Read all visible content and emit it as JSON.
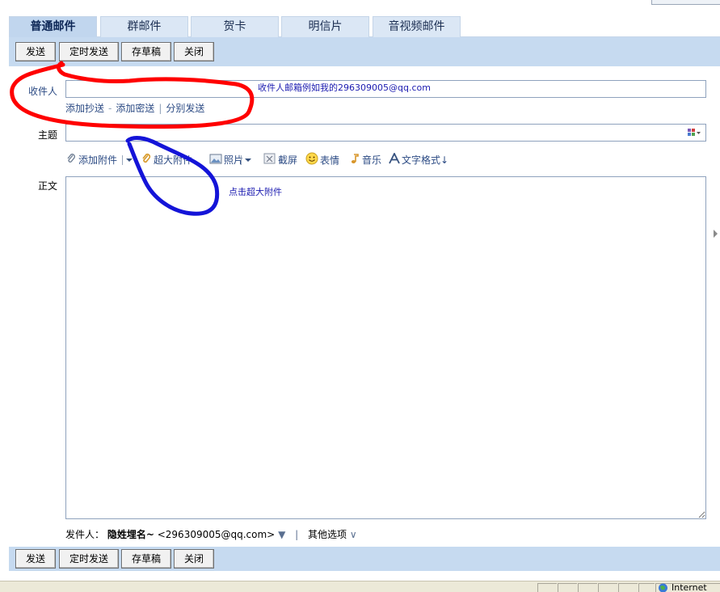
{
  "tabs": [
    {
      "label": "普通邮件",
      "active": true
    },
    {
      "label": "群邮件",
      "active": false
    },
    {
      "label": "贺卡",
      "active": false
    },
    {
      "label": "明信片",
      "active": false
    },
    {
      "label": "音视频邮件",
      "active": false
    }
  ],
  "toolbar": {
    "send": "发送",
    "scheduled_send": "定时发送",
    "save_draft": "存草稿",
    "close": "关闭"
  },
  "form": {
    "recipient_label": "收件人",
    "recipient_value": "",
    "add_cc": "添加抄送",
    "add_bcc": "添加密送",
    "separate_send": "分别发送",
    "subject_label": "主题",
    "subject_value": "",
    "body_label": "正文"
  },
  "attach_toolbar": {
    "add_attachment": "添加附件",
    "super_attachment": "超大附件",
    "photo": "照片",
    "screenshot": "截屏",
    "emoji": "表情",
    "music": "音乐",
    "text_format": "文字格式↓"
  },
  "sender": {
    "label": "发件人：",
    "name": "隐姓埋名~",
    "email": "<296309005@qq.com>",
    "dropdown_glyph": "▼",
    "divider": "|",
    "other_options": "其他选项",
    "other_options_glyph": "∨"
  },
  "annotations": {
    "recipient_hint": "收件人邮箱例如我的296309005@qq.com",
    "super_attach_hint": "点击超大附件"
  },
  "status_bar": {
    "zone": "Internet"
  },
  "colors": {
    "toolbar_bg": "#c6daf0",
    "tab_bg": "#dbe7f5",
    "link_blue": "#2c4b84",
    "marker_red": "#ff0000",
    "marker_blue": "#1414d8"
  }
}
